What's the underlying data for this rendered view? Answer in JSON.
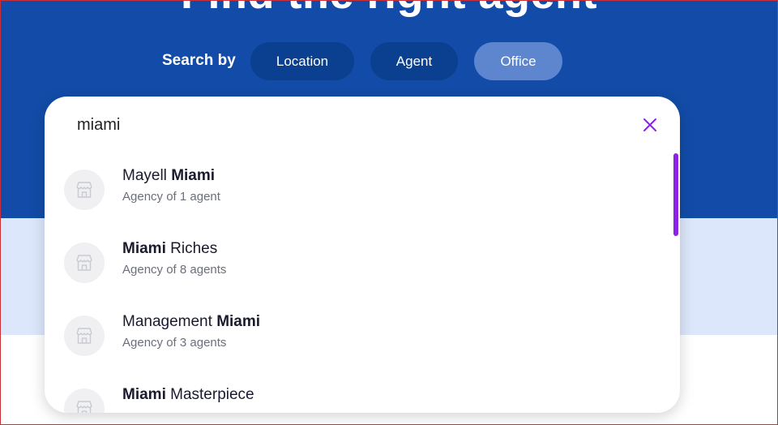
{
  "hero": {
    "title": "Find the right agent",
    "search_by_label": "Search by",
    "tabs": [
      {
        "label": "Location",
        "active": false
      },
      {
        "label": "Agent",
        "active": false
      },
      {
        "label": "Office",
        "active": true
      }
    ]
  },
  "search": {
    "value": "miami",
    "close_icon": "close-icon"
  },
  "results": [
    {
      "name_parts": [
        {
          "text": "Mayell ",
          "bold": false
        },
        {
          "text": "Miami",
          "bold": true
        }
      ],
      "subtitle": "Agency of 1 agent",
      "icon": "storefront-icon"
    },
    {
      "name_parts": [
        {
          "text": "Miami",
          "bold": true
        },
        {
          "text": " Riches",
          "bold": false
        }
      ],
      "subtitle": "Agency of 8 agents",
      "icon": "storefront-icon"
    },
    {
      "name_parts": [
        {
          "text": "Management ",
          "bold": false
        },
        {
          "text": "Miami",
          "bold": true
        }
      ],
      "subtitle": "Agency of 3 agents",
      "icon": "storefront-icon"
    },
    {
      "name_parts": [
        {
          "text": "Miami",
          "bold": true
        },
        {
          "text": " Masterpiece",
          "bold": false
        }
      ],
      "subtitle": "",
      "icon": "storefront-icon"
    }
  ],
  "colors": {
    "hero_blue": "#124ca8",
    "pill_dark": "#0b3f8f",
    "pill_active": "#5d86cf",
    "accent_purple": "#8b22e6",
    "light_band": "#dde7fb"
  }
}
